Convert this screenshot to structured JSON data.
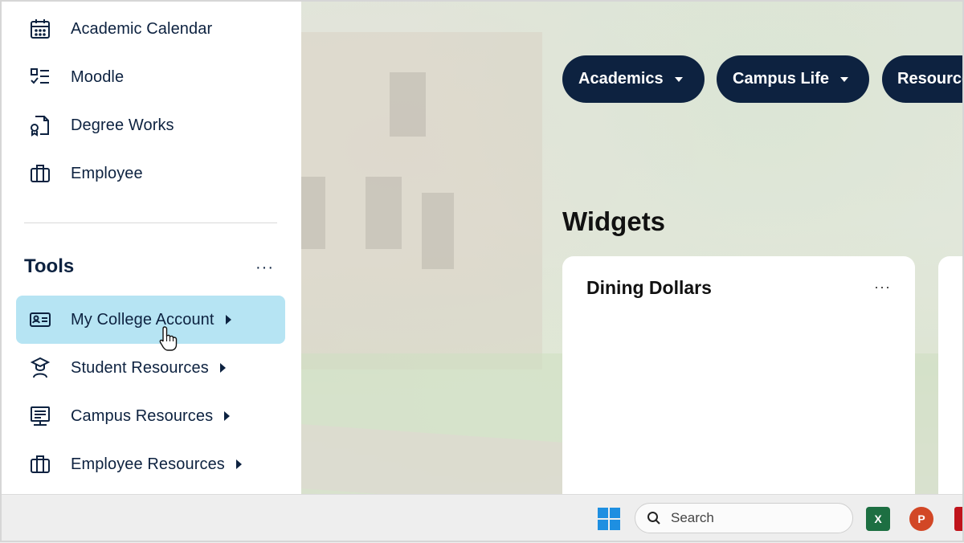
{
  "sidebar": {
    "items": [
      {
        "label": "Academic Calendar",
        "icon": "calendar-icon"
      },
      {
        "label": "Moodle",
        "icon": "checklist-icon"
      },
      {
        "label": "Degree Works",
        "icon": "certificate-document-icon"
      },
      {
        "label": "Employee",
        "icon": "briefcase-icon"
      }
    ],
    "tools_title": "Tools",
    "tools_more": "···",
    "tools": [
      {
        "label": "My College Account",
        "icon": "id-card-icon",
        "active": true
      },
      {
        "label": "Student Resources",
        "icon": "student-icon"
      },
      {
        "label": "Campus Resources",
        "icon": "presentation-board-icon"
      },
      {
        "label": "Employee Resources",
        "icon": "briefcase-icon"
      }
    ]
  },
  "nav_pills": [
    {
      "label": "Academics"
    },
    {
      "label": "Campus Life"
    },
    {
      "label": "Resource"
    }
  ],
  "widgets": {
    "title": "Widgets",
    "card_title": "Dining Dollars",
    "card_more": "···"
  },
  "taskbar": {
    "search_placeholder": "Search",
    "apps": [
      "windows-start-icon",
      "excel-icon",
      "powerpoint-icon",
      "acrobat-icon"
    ]
  },
  "colors": {
    "navy": "#0d2240",
    "active_bg": "#b6e4f3"
  }
}
